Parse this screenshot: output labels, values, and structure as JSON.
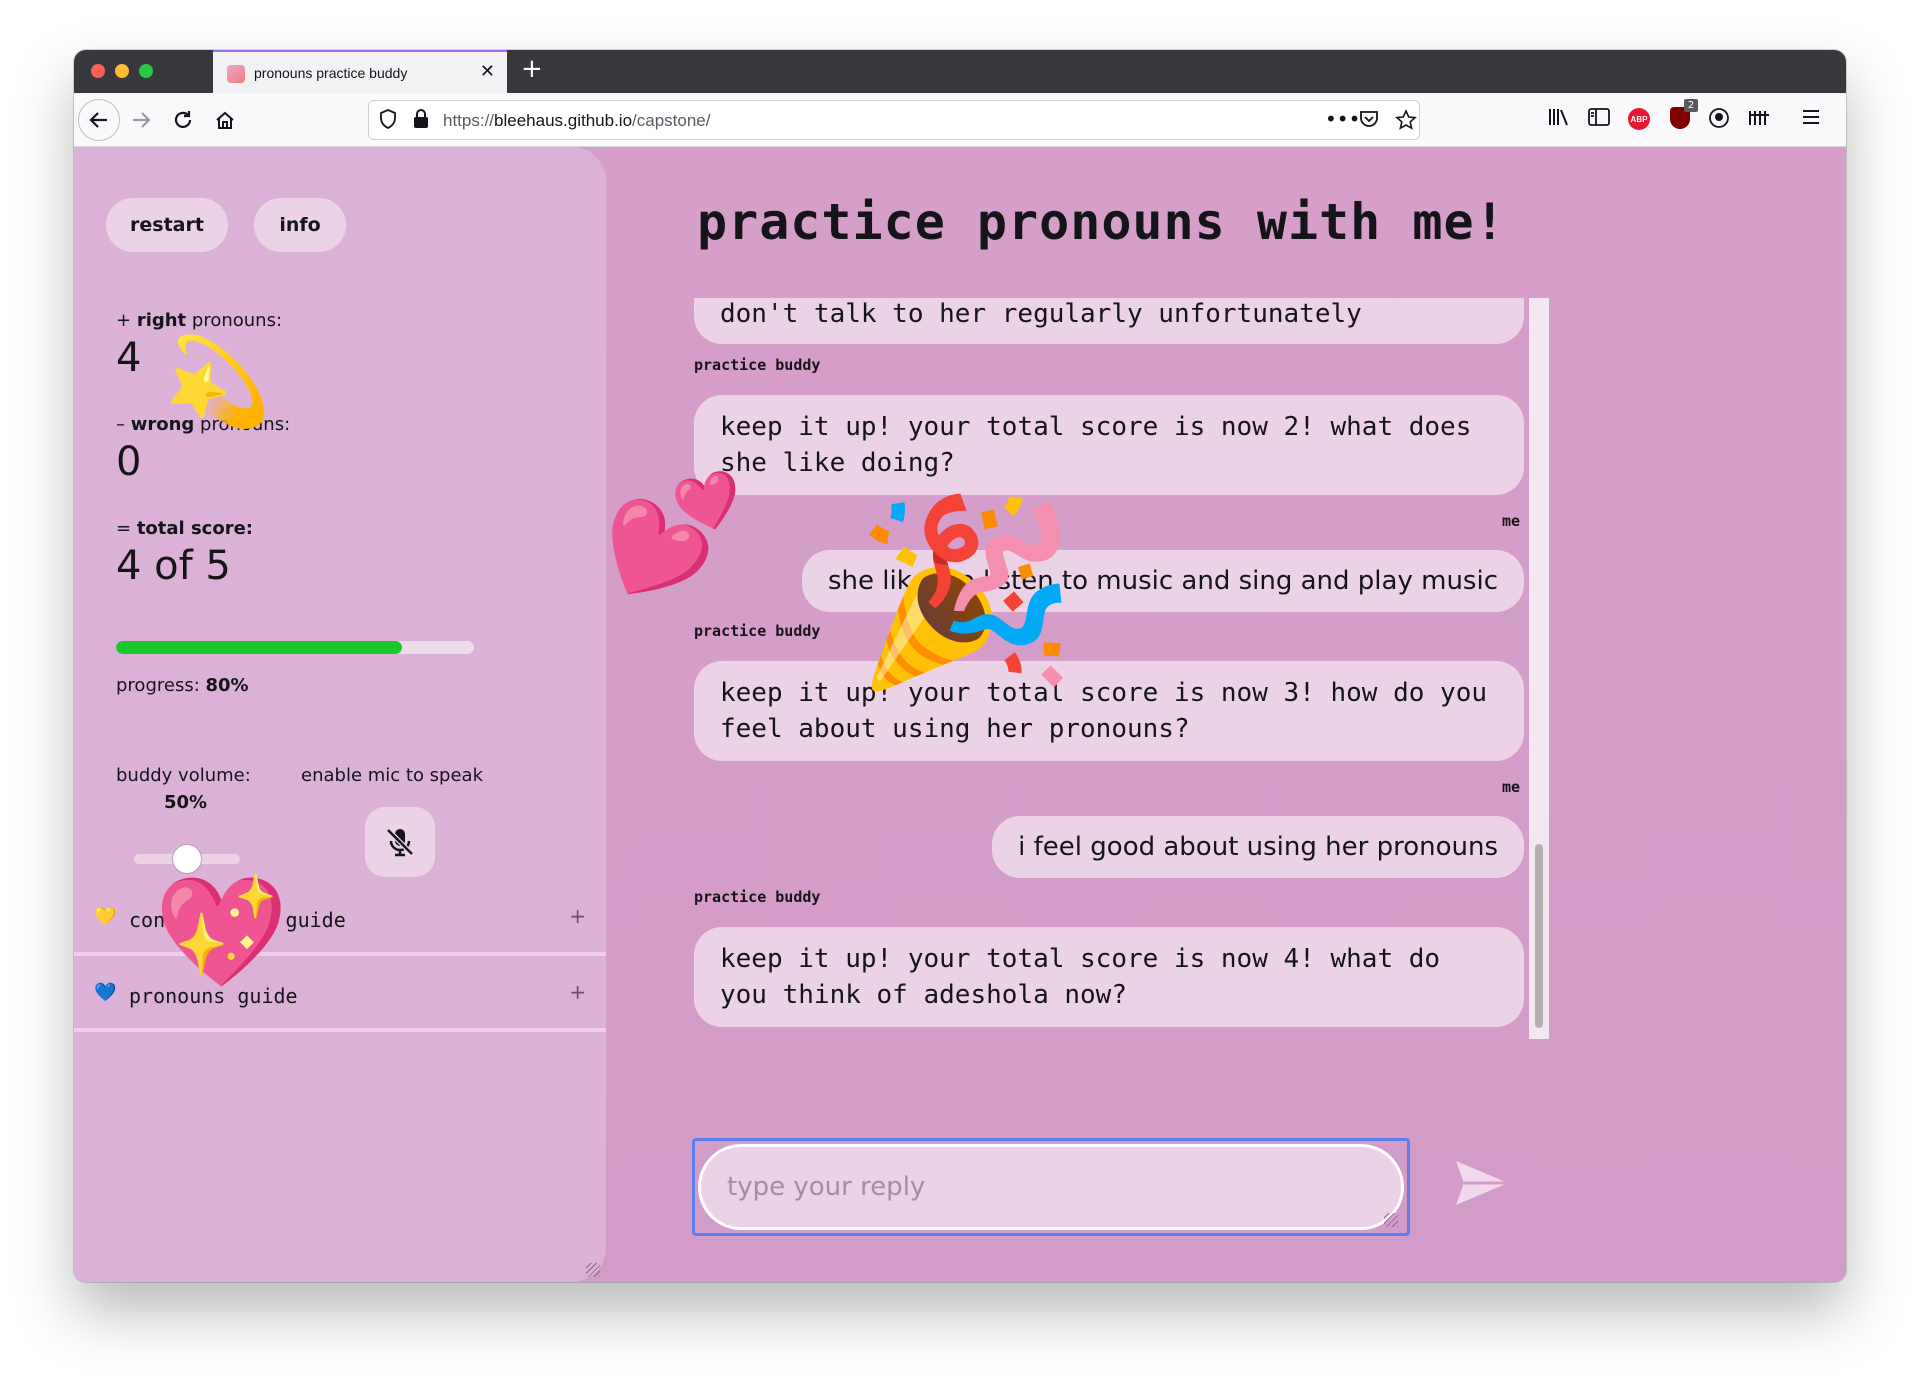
{
  "browser": {
    "tab_title": "pronouns practice buddy",
    "url_prefix": "https://",
    "url_domain": "bleehaus.github.io",
    "url_path": "/capstone/",
    "abp_label": "ABP",
    "ublock_badge": "2"
  },
  "sidebar": {
    "restart_label": "restart",
    "info_label": "info",
    "right_prefix": "+ ",
    "right_bold": "right",
    "right_suffix": " pronouns:",
    "right_value": "4",
    "wrong_prefix": "– ",
    "wrong_bold": "wrong",
    "wrong_suffix": " pronouns:",
    "wrong_value": "0",
    "total_prefix": "= ",
    "total_bold": "total score:",
    "total_value": "4 of 5",
    "progress_label": "progress: ",
    "progress_value": "80%",
    "progress_fraction": 0.8,
    "volume_label": "buddy volume:",
    "volume_value": "50%",
    "volume_fraction": 0.5,
    "mic_label": "enable mic to speak",
    "guides": [
      {
        "emoji": "💛",
        "label": "conversation guide",
        "toggle": "+"
      },
      {
        "emoji": "💙",
        "label": "pronouns guide",
        "toggle": "+"
      }
    ]
  },
  "main": {
    "title": "practice pronouns with me!",
    "messages": [
      {
        "sender": "",
        "text": "don't talk to her regularly unfortunately"
      },
      {
        "sender": "practice buddy",
        "text": "keep it up! your total score is now 2! what does she like doing?"
      },
      {
        "sender": "me",
        "text": "she likes to listen to music and sing and play music"
      },
      {
        "sender": "practice buddy",
        "text": "keep it up! your total score is now 3! how do you feel about using her pronouns?"
      },
      {
        "sender": "me",
        "text": "i feel good about using her pronouns"
      },
      {
        "sender": "practice buddy",
        "text": "keep it up! your total score is now 4! what do you think of adeshola now?"
      }
    ],
    "reply_placeholder": "type your reply"
  },
  "stickers": {
    "dizzy": "💫",
    "hearts": "💕",
    "party": "🎉",
    "sparkling_heart": "💖"
  }
}
